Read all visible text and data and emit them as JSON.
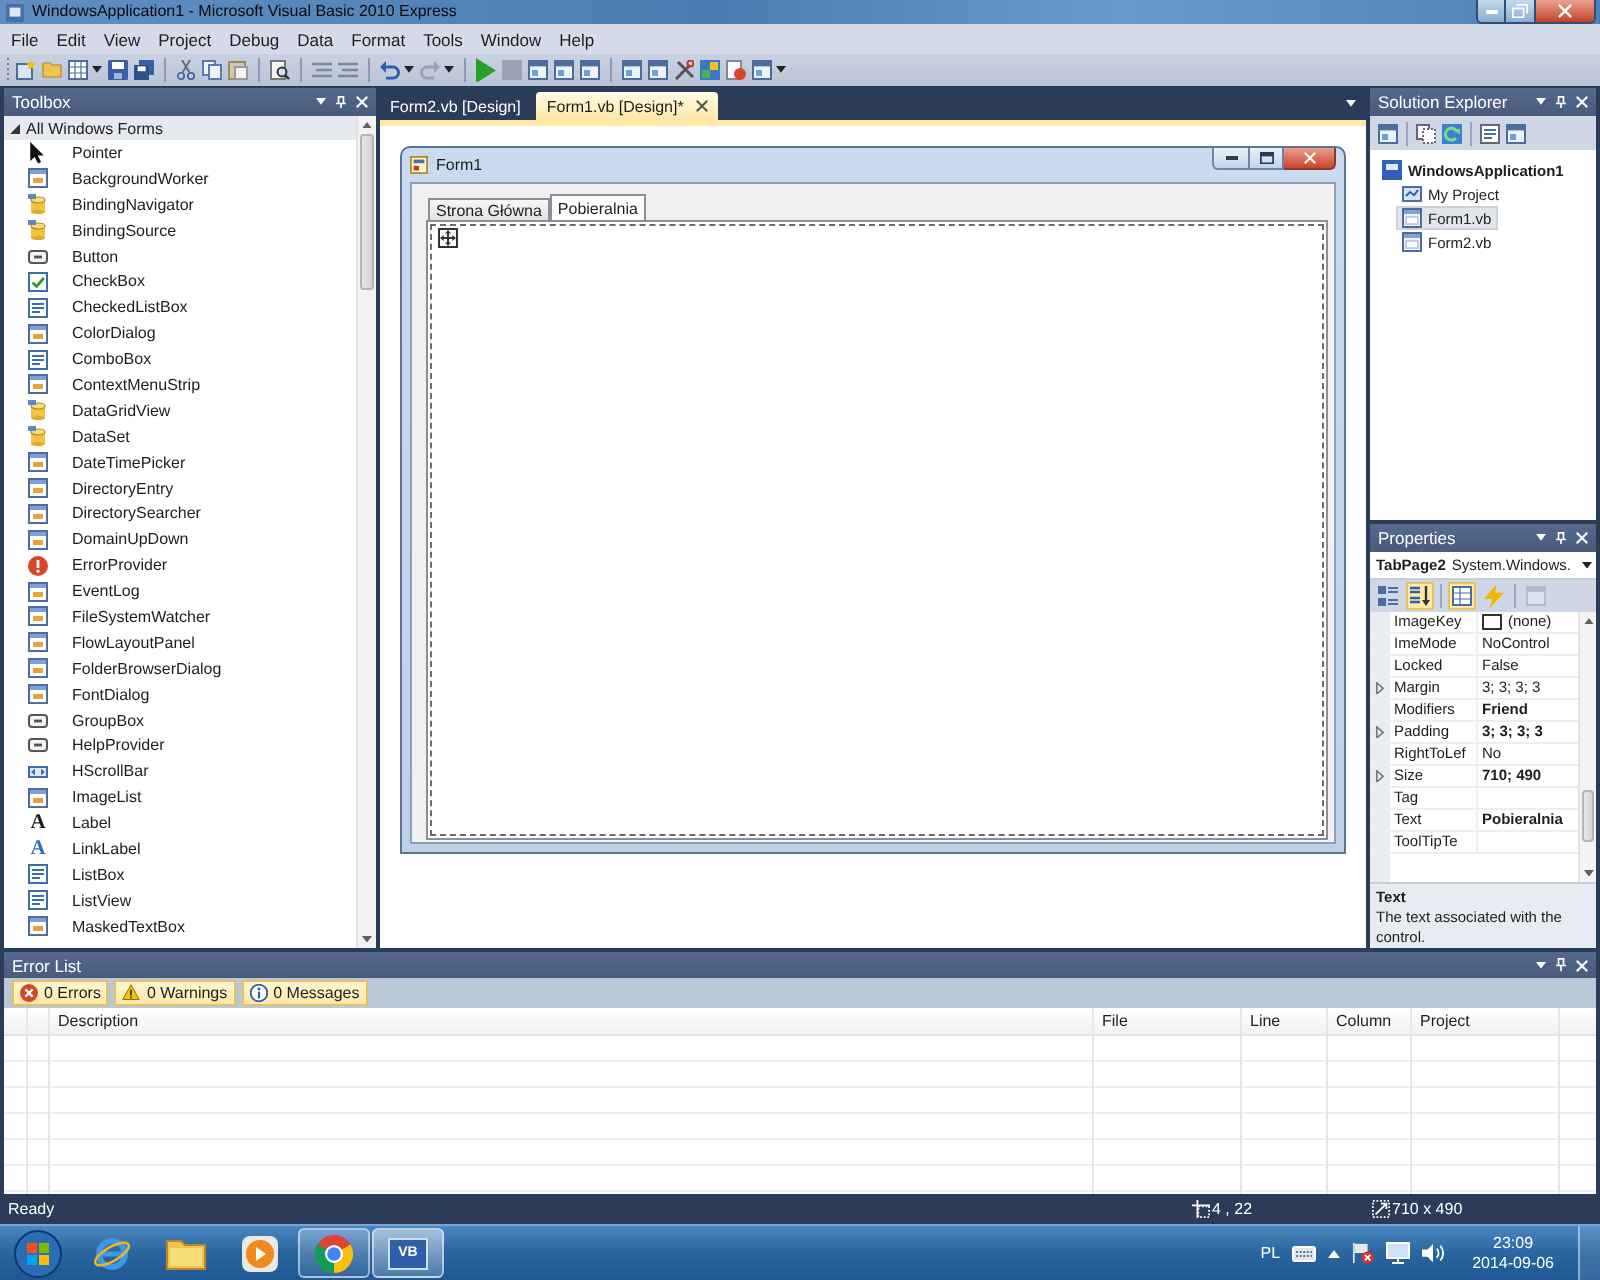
{
  "window": {
    "title": "WindowsApplication1 - Microsoft Visual Basic 2010 Express"
  },
  "menu": [
    "File",
    "Edit",
    "View",
    "Project",
    "Debug",
    "Data",
    "Format",
    "Tools",
    "Window",
    "Help"
  ],
  "toolbox": {
    "title": "Toolbox",
    "category": {
      "label": "All Windows Forms",
      "expanded": true
    },
    "items": [
      {
        "label": "Pointer"
      },
      {
        "label": "BackgroundWorker"
      },
      {
        "label": "BindingNavigator"
      },
      {
        "label": "BindingSource"
      },
      {
        "label": "Button"
      },
      {
        "label": "CheckBox"
      },
      {
        "label": "CheckedListBox"
      },
      {
        "label": "ColorDialog"
      },
      {
        "label": "ComboBox"
      },
      {
        "label": "ContextMenuStrip"
      },
      {
        "label": "DataGridView"
      },
      {
        "label": "DataSet"
      },
      {
        "label": "DateTimePicker"
      },
      {
        "label": "DirectoryEntry"
      },
      {
        "label": "DirectorySearcher"
      },
      {
        "label": "DomainUpDown"
      },
      {
        "label": "ErrorProvider"
      },
      {
        "label": "EventLog"
      },
      {
        "label": "FileSystemWatcher"
      },
      {
        "label": "FlowLayoutPanel"
      },
      {
        "label": "FolderBrowserDialog"
      },
      {
        "label": "FontDialog"
      },
      {
        "label": "GroupBox"
      },
      {
        "label": "HelpProvider"
      },
      {
        "label": "HScrollBar"
      },
      {
        "label": "ImageList"
      },
      {
        "label": "Label",
        "glyph": "A"
      },
      {
        "label": "LinkLabel",
        "glyph": "A"
      },
      {
        "label": "ListBox"
      },
      {
        "label": "ListView"
      },
      {
        "label": "MaskedTextBox"
      }
    ]
  },
  "document_tabs": [
    {
      "label": "Form2.vb [Design]",
      "selected": false
    },
    {
      "label": "Form1.vb [Design]*",
      "selected": true
    }
  ],
  "designer": {
    "form": {
      "title": "Form1",
      "tabs": [
        {
          "label": "Strona Główna",
          "selected": false
        },
        {
          "label": "Pobieralnia",
          "selected": true
        }
      ]
    }
  },
  "solution_explorer": {
    "title": "Solution Explorer",
    "tree": [
      {
        "label": "WindowsApplication1",
        "selected": false,
        "children": [
          {
            "label": "My Project",
            "selected": false
          },
          {
            "label": "Form1.vb",
            "selected": true
          },
          {
            "label": "Form2.vb",
            "selected": false
          }
        ]
      }
    ]
  },
  "properties": {
    "title": "Properties",
    "object_name": "TabPage2",
    "object_type": "System.Windows.",
    "toolbar": [
      {
        "on": false,
        "disabled": false
      },
      {
        "on": true,
        "disabled": false
      },
      {
        "on": true,
        "disabled": false
      },
      {
        "on": false,
        "disabled": false
      },
      {
        "on": false,
        "disabled": true
      }
    ],
    "rows": [
      {
        "name": "ImageKey",
        "value": "(none)",
        "kind": "image",
        "expandable": false,
        "modified": false
      },
      {
        "name": "ImeMode",
        "value": "NoControl",
        "kind": "text",
        "expandable": false,
        "modified": false
      },
      {
        "name": "Locked",
        "value": "False",
        "kind": "text",
        "expandable": false,
        "modified": false
      },
      {
        "name": "Margin",
        "value": "3; 3; 3; 3",
        "kind": "text",
        "expandable": true,
        "modified": false
      },
      {
        "name": "Modifiers",
        "value": "Friend",
        "kind": "text",
        "expandable": false,
        "modified": true
      },
      {
        "name": "Padding",
        "value": "3; 3; 3; 3",
        "kind": "text",
        "expandable": true,
        "modified": true
      },
      {
        "name": "RightToLef",
        "value": "No",
        "kind": "text",
        "expandable": false,
        "modified": false
      },
      {
        "name": "Size",
        "value": "710; 490",
        "kind": "text",
        "expandable": true,
        "modified": true
      },
      {
        "name": "Tag",
        "kind": "text",
        "expandable": false
      },
      {
        "name": "Text",
        "value": "Pobieralnia",
        "kind": "text",
        "expandable": false,
        "modified": true
      },
      {
        "name": "ToolTipTe",
        "kind": "text",
        "expandable": false
      }
    ],
    "description": {
      "title": "Text",
      "text": "The text associated with the control."
    }
  },
  "error_list": {
    "title": "Error List",
    "filters": [
      {
        "kind": "error",
        "label": "0 Errors",
        "on": true
      },
      {
        "kind": "warning",
        "label": "0 Warnings",
        "on": true
      },
      {
        "kind": "info",
        "label": "0 Messages",
        "on": true
      }
    ],
    "columns": [
      "Description",
      "File",
      "Line",
      "Column",
      "Project"
    ]
  },
  "status_bar": {
    "message": "Ready",
    "position": "4 , 22",
    "size": "710 x 490"
  },
  "taskbar": {
    "apps": [
      {
        "running": false,
        "selected": false
      },
      {
        "running": false,
        "selected": false
      },
      {
        "running": false,
        "selected": false
      },
      {
        "running": true,
        "selected": false
      },
      {
        "running": true,
        "selected": true,
        "glyph": "VB"
      }
    ],
    "tray": {
      "language": "PL",
      "time": "23:09",
      "date": "2014-09-06"
    }
  }
}
